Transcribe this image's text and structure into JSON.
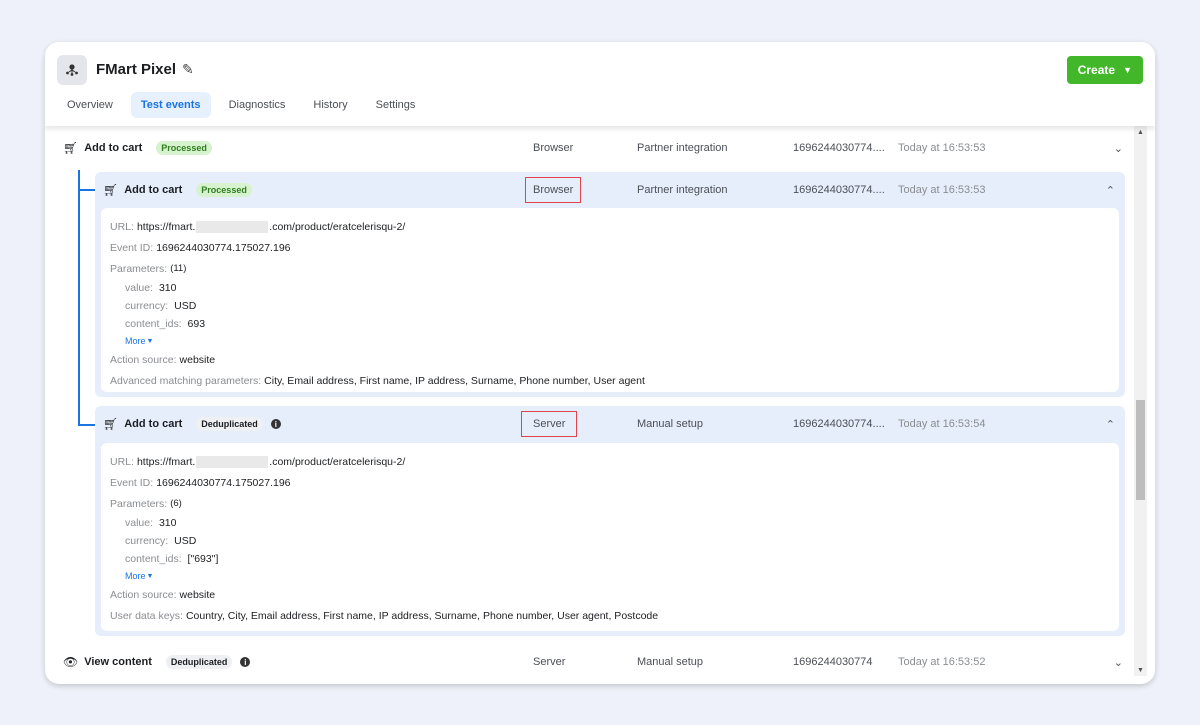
{
  "header": {
    "title": "FMart Pixel",
    "edit_icon": "pencil-icon",
    "create_label": "Create",
    "tabs": [
      {
        "label": "Overview",
        "active": false
      },
      {
        "label": "Test events",
        "active": true
      },
      {
        "label": "Diagnostics",
        "active": false
      },
      {
        "label": "History",
        "active": false
      },
      {
        "label": "Settings",
        "active": false
      }
    ]
  },
  "events": [
    {
      "name": "Add to cart",
      "status": "Processed",
      "source": "Browser",
      "setup": "Partner integration",
      "event_id_short": "1696244030774....",
      "time": "Today at 16:53:53"
    },
    {
      "name": "Add to cart",
      "status": "Processed",
      "source": "Browser",
      "setup": "Partner integration",
      "event_id_short": "1696244030774....",
      "time": "Today at 16:53:53",
      "details": {
        "url_label": "URL:",
        "url_prefix": "https://fmart.",
        "url_suffix": ".com/product/eratcelerisqu-2/",
        "event_id_label": "Event ID:",
        "event_id": "1696244030774.175027.196",
        "params_label": "Parameters:",
        "params_count": "(11)",
        "params": [
          {
            "key": "value:",
            "val": "310"
          },
          {
            "key": "currency:",
            "val": "USD"
          },
          {
            "key": "content_ids:",
            "val": "693"
          }
        ],
        "more": "More",
        "action_label": "Action source:",
        "action": "website",
        "extra_label": "Advanced matching parameters:",
        "extra": "City, Email address, First name, IP address, Surname, Phone number, User agent"
      }
    },
    {
      "name": "Add to cart",
      "status": "Deduplicated",
      "source": "Server",
      "setup": "Manual setup",
      "event_id_short": "1696244030774....",
      "time": "Today at 16:53:54",
      "details": {
        "url_label": "URL:",
        "url_prefix": "https://fmart.",
        "url_suffix": ".com/product/eratcelerisqu-2/",
        "event_id_label": "Event ID:",
        "event_id": "1696244030774.175027.196",
        "params_label": "Parameters:",
        "params_count": "(6)",
        "params": [
          {
            "key": "value:",
            "val": "310"
          },
          {
            "key": "currency:",
            "val": "USD"
          },
          {
            "key": "content_ids:",
            "val": "[\"693\"]"
          }
        ],
        "more": "More",
        "action_label": "Action source:",
        "action": "website",
        "extra_label": "User data keys:",
        "extra": "Country, City, Email address, First name, IP address, Surname, Phone number, User agent, Postcode"
      }
    },
    {
      "name": "View content",
      "status": "Deduplicated",
      "source": "Server",
      "setup": "Manual setup",
      "event_id_short": "1696244030774",
      "time": "Today at 16:53:52"
    }
  ]
}
